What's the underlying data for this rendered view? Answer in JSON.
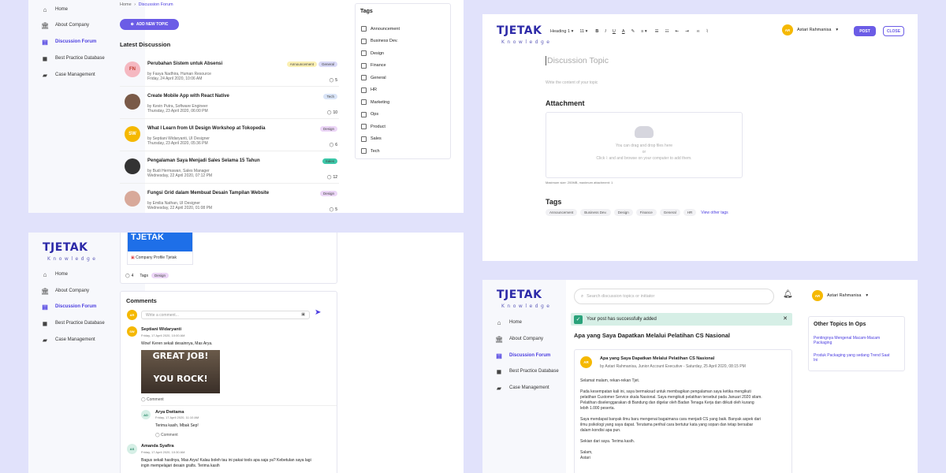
{
  "nav": {
    "home": "Home",
    "about": "About Company",
    "forum": "Discussion Forum",
    "best": "Best Practice Database",
    "case": "Case Management"
  },
  "logo": {
    "name": "TJETAK",
    "sub": "Knowledge"
  },
  "p1": {
    "breadcrumb_home": "Home",
    "breadcrumb_sep": "›",
    "breadcrumb_current": "Discussion Forum",
    "add_button": "ADD NEW TOPIC",
    "latest": "Latest Discussion",
    "tags_title": "Tags",
    "tags": [
      "Announcement",
      "Business Dev.",
      "Design",
      "Finance",
      "General",
      "HR",
      "Marketing",
      "Ops",
      "Product",
      "Sales",
      "Tech"
    ],
    "items": [
      {
        "initials": "FN",
        "title": "Perubahan Sistem untuk Absensi",
        "meta": "by Fasya Nadhira, Human Resource",
        "date": "Friday, 24 April 2020, 10:06 AM",
        "count": "5",
        "badges": [
          "Announcement",
          "General"
        ],
        "color": "#f5b8c1"
      },
      {
        "initials": "",
        "title": "Create Mobile App with React Native",
        "meta": "by Kevin Putra, Software Engineer",
        "date": "Thursday, 23 April 2020, 06:00 PM",
        "count": "10",
        "badges": [
          "Tech"
        ],
        "color": "#7a5a48"
      },
      {
        "initials": "SW",
        "title": "What I Learn from UI Design Workshop at Tokopedia",
        "meta": "by Septiani Widaryanti, UI Designer",
        "date": "Thursday, 23 April 2020, 05:36 PM",
        "count": "6",
        "badges": [
          "Design"
        ],
        "color": "#f5b800"
      },
      {
        "initials": "",
        "title": "Pengalaman Saya Menjadi Sales Selama 15 Tahun",
        "meta": "by Budi Hermawan, Sales Manager",
        "date": "Wednesday, 22 April 2020, 07:12 PM",
        "count": "12",
        "badges": [
          "Sales"
        ],
        "color": "#333333"
      },
      {
        "initials": "",
        "title": "Fungsi Grid dalam Membuat Desain Tampilan Website",
        "meta": "by Emilia Nathan, UI Designer",
        "date": "Wednesday, 22 April 2020, 01:08 PM",
        "count": "5",
        "badges": [
          "Design"
        ],
        "color": "#d8a99a"
      }
    ]
  },
  "p2": {
    "heading_select": "Heading 1",
    "size_select": "11",
    "user": "Astari Rahmanisa",
    "user_initials": "AR",
    "post": "POST",
    "close": "CLOSE",
    "topic_placeholder": "Discussion Topic",
    "content_placeholder": "Write the content of your topic",
    "attachment": "Attachment",
    "drop_text": "You can drag and drop files here",
    "or": "or",
    "click": "Click",
    "click_rest": "and and browse on your computer to add them.",
    "max": "Maximum size: 200MB, maximum attachment: 1",
    "tags_title": "Tags",
    "tags": [
      "Announcement",
      "Business Dev.",
      "Design",
      "Finance",
      "General",
      "HR"
    ],
    "view_other": "View other tags"
  },
  "p3": {
    "image_text": "TJETAK",
    "file": "Company Profile Tjetak",
    "count": "4",
    "tags_label": "Tags",
    "tag": "Design",
    "comments_title": "Comments",
    "me_initials": "AR",
    "write_placeholder": "Write a comment...",
    "c1_name": "Septiani Widaryanti",
    "c1_initials": "SW",
    "c1_date": "Friday, 17 April 2020, 10:00 AM",
    "c1_text": "Wow! Keren sekali desainnya, Mas Arya.",
    "meme_top": "GREAT JOB!",
    "meme_bottom": "YOU ROCK!",
    "comment_label": "Comment",
    "c2_name": "Arya Dwitama",
    "c2_initials": "AD",
    "c2_date": "Friday, 17 April 2020, 11:10 AM",
    "c2_text": "Terima kasih, Mbak Sep!",
    "c3_name": "Amanda Syafira",
    "c3_initials": "AS",
    "c3_date": "Friday, 17 April 2020, 10:30 AM",
    "c3_text1": "Bagus sekali hasilnya, Mas Arya! Kalau boleh tau ini pakai tools apa saja ya? Kebetulan saya lagi",
    "c3_text2": "ingin mempelajari desain grafis. Terima kasih"
  },
  "p4": {
    "search_placeholder": "Search discussion topics or initiator",
    "user": "Astari Rahmanisa",
    "user_initials": "AR",
    "success": "Your post has successfully added",
    "title": "Apa yang Saya Dapatkan Melalui Pelatihan CS Nasional",
    "post_title": "Apa yang Saya Dapatkan Melalui Pelatihan CS Nasional",
    "post_meta": "by Astari Rahmanisa, Junior Account Executive - Saturday, 25 April 2020, 08:15 PM",
    "greeting": "Selamat malam, rekan-rekan Tjet.",
    "para1": [
      "Pada kesempatan kali ini, saya bermaksud untuk membagikan pengalaman saya ketika mengikuti",
      "pelatihan Customer Service skala Nasional. Saya mengikuti pelatihan tersebut pada Januari 2020 silam.",
      "Pelatihan diselenggarakan di Bandung dan digelar oleh Badan Tenaga Kerja dan diikuti oleh kurang",
      "lebih 1.000 peserta."
    ],
    "para2": [
      "Saya mendapat banyak ilmu baru mengenai bagaimana cara menjadi CS yang baik. Banyak aspek dari",
      "ilmu psikologi yang saya dapat. Terutama perihal cara bertutur kata yang sopan dan tetap bersabar",
      "dalam kondisi apa pun."
    ],
    "para3": "Sekian dari saya. Terima kasih.",
    "salam": "Salam,",
    "sign": "Astari",
    "other_title": "Other Topics In Ops",
    "other1": [
      "Pentingnya Mengenal Macam-Macam",
      "Packaging"
    ],
    "other2": [
      "Produk Packaging yang sedang Trend Saat",
      "Ini"
    ]
  },
  "colors": {
    "accent": "#4b3de0",
    "bg": "#e1e2fb",
    "success": "#d6efe6"
  }
}
